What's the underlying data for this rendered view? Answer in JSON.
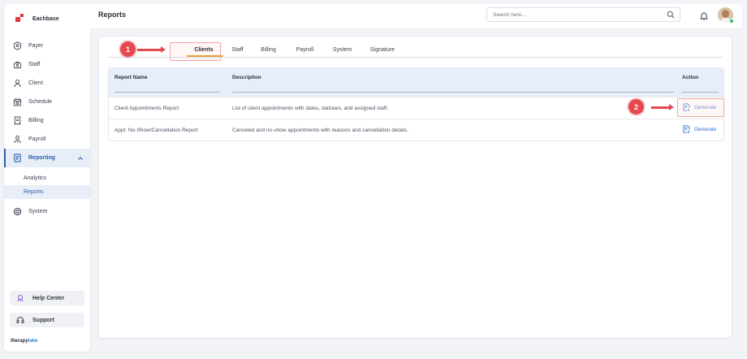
{
  "app": {
    "name": "Eachbase"
  },
  "sidebar": {
    "items": [
      {
        "label": "Payer",
        "icon": "payer-icon"
      },
      {
        "label": "Staff",
        "icon": "staff-icon"
      },
      {
        "label": "Client",
        "icon": "client-icon"
      },
      {
        "label": "Schedule",
        "icon": "calendar-icon"
      },
      {
        "label": "Billing",
        "icon": "billing-icon"
      },
      {
        "label": "Payroll",
        "icon": "payroll-icon"
      },
      {
        "label": "Reporting",
        "icon": "reporting-icon",
        "expanded": true,
        "active": true
      },
      {
        "label": "System",
        "icon": "system-icon"
      }
    ],
    "subitems": [
      {
        "label": "Analytics"
      },
      {
        "label": "Reports",
        "active": true
      }
    ],
    "help_center": "Help Center",
    "support": "Support",
    "footer_logo_a": "therapy",
    "footer_logo_b": "lake"
  },
  "header": {
    "title": "Reports",
    "search_placeholder": "Search here..."
  },
  "tabs": [
    {
      "label": "Clients",
      "active": true
    },
    {
      "label": "Staff"
    },
    {
      "label": "Billing"
    },
    {
      "label": "Payroll"
    },
    {
      "label": "System"
    },
    {
      "label": "Signature"
    }
  ],
  "table": {
    "columns": [
      "Report Name",
      "Description",
      "Action"
    ],
    "rows": [
      {
        "name": "Client Appointments Report",
        "description": "List of client appointments with dates, statuses, and assigned staff.",
        "action": "Generate"
      },
      {
        "name": "Appt. No-Show/Cancellation Report",
        "description": "Canceled and no-show appointments with reasons and cancellation details.",
        "action": "Generate"
      }
    ]
  },
  "annotations": {
    "step1": "1",
    "step2": "2",
    "color": "#e5484d"
  },
  "colors": {
    "accent": "#2b5fb0",
    "link": "#2b6ad1",
    "tab_underline": "#e8a23a",
    "brand": "#e4383e"
  }
}
